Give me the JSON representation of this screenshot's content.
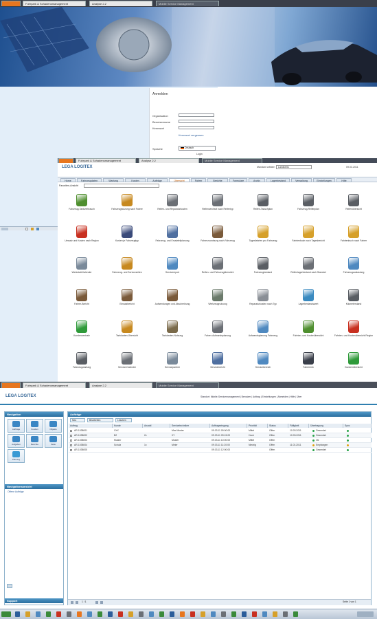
{
  "screen1": {
    "tabs": [
      "",
      "Fuhrpark & Schadensmanagement",
      "Analyse 2.2",
      "Mobile Service Management"
    ],
    "login": {
      "title": "Anmelden",
      "fields": [
        {
          "label": "Organisation",
          "value": ""
        },
        {
          "label": "Benutzername",
          "value": ""
        },
        {
          "label": "Kennwort",
          "value": ""
        }
      ],
      "forgot": "Kennwort vergessen",
      "language_label": "Sprache",
      "language_value": "Deutsch",
      "login_button": "Login"
    }
  },
  "screen2": {
    "tabs": [
      "",
      "Fuhrpark & Schadensmanagement",
      "Analyse 2.2",
      "Mobile Service Management"
    ],
    "logo": "LEGA LOGITEX",
    "mandant_label": "Mandant wählen",
    "mandant_value": "Landkreis",
    "date": "09.03.2011",
    "menu": [
      "Home",
      "Fahrzeugdaten",
      "Wartung",
      "Kosten",
      "Aufträge",
      "Übersicht",
      "Fahrer",
      "Berichte",
      "Formulare",
      "Archiv",
      "Lagerbestand",
      "Verwaltung",
      "Einstellungen",
      "Hilfe"
    ],
    "filter_label": "Favoriten-Ansicht",
    "icons": [
      {
        "label": "Fahrzeug-Tankverbrauch",
        "color": "#4f8f2f"
      },
      {
        "label": "Fahrzeugnutzung nach Fahrer",
        "color": "#c7891f"
      },
      {
        "label": "Reifen- und Reparaturkosten",
        "color": "#6b6f75"
      },
      {
        "label": "Reifenwechsel nach Reifentyp",
        "color": "#6b6f75"
      },
      {
        "label": "Reifen-Tauschplan",
        "color": "#5a5e64"
      },
      {
        "label": "Fahrzeug-Reifenplan",
        "color": "#5a5e64"
      },
      {
        "label": "Reifenübersicht",
        "color": "#5a5e64"
      },
      {
        "label": "Umsatz und Kosten nach Region",
        "color": "#c83020"
      },
      {
        "label": "Kosten je Fahrzeugtyp",
        "color": "#3a4a7a"
      },
      {
        "label": "Fahrzeug- und Ersatzteilplanung",
        "color": "#4f6fa0"
      },
      {
        "label": "Fahrerzuordnung nach Fahrzeug",
        "color": "#7a5a3a"
      },
      {
        "label": "Tagesfahrten pro Fahrzeug",
        "color": "#d6a02a"
      },
      {
        "label": "Fahrtenbuch nach Tagesbericht",
        "color": "#d6a02a"
      },
      {
        "label": "Fahrtenbuch nach Fahrer",
        "color": "#d6a02a"
      },
      {
        "label": "Werkstatt-Kalender",
        "color": "#7a8a9a"
      },
      {
        "label": "Fahrzeug- und Servicezeiten",
        "color": "#c7891f"
      },
      {
        "label": "Servicereport",
        "color": "#4f89c0"
      },
      {
        "label": "Reifen- und Fahrzeugübersicht",
        "color": "#6b6f75"
      },
      {
        "label": "Fahrzeugbestand",
        "color": "#5a5e64"
      },
      {
        "label": "Reifenlagerbestand nach Standort",
        "color": "#6b6f75"
      },
      {
        "label": "Fahrzeugauslastung",
        "color": "#4f89c0"
      },
      {
        "label": "Fahrer-Bericht",
        "color": "#7a5a3a"
      },
      {
        "label": "Einsatzbericht",
        "color": "#7a5a3a"
      },
      {
        "label": "Aufwendungen und Abschreibung",
        "color": "#7a5a3a"
      },
      {
        "label": "Werkzeugnutzung",
        "color": "#6b7a6b"
      },
      {
        "label": "Reparaturkosten nach Typ",
        "color": "#8a8f96"
      },
      {
        "label": "Lagerbestandswert",
        "color": "#3a8ac0"
      },
      {
        "label": "Kilometerstand",
        "color": "#5a5e64"
      },
      {
        "label": "Kundenzentrale",
        "color": "#2f9a3a"
      },
      {
        "label": "Tankkarten-Übersicht",
        "color": "#c7891f"
      },
      {
        "label": "Tankkarten-Nutzung",
        "color": "#7a6a4a"
      },
      {
        "label": "Fahrer-Aufwandsplanung",
        "color": "#6b6f75"
      },
      {
        "label": "Aufwandsplanung Fahrzeug",
        "color": "#4f89c0"
      },
      {
        "label": "Fahrten- und Kostenübersicht",
        "color": "#4f8f2f"
      },
      {
        "label": "Fahrten- und Kostenübersicht Region",
        "color": "#c83020"
      },
      {
        "label": "Fahrzeugwartung",
        "color": "#5a5e64"
      },
      {
        "label": "Service-Kalender",
        "color": "#6b6f75"
      },
      {
        "label": "Servicepartner",
        "color": "#7a8a9a"
      },
      {
        "label": "Servicebericht",
        "color": "#4f6fa0"
      },
      {
        "label": "Servicebereich",
        "color": "#4f89c0"
      },
      {
        "label": "Fahrerinfo",
        "color": "#3a3f4a"
      },
      {
        "label": "Kundenübersicht",
        "color": "#2f9a3a"
      }
    ]
  },
  "screen3": {
    "tabs": [
      "",
      "Fuhrpark & Schadensmanagement",
      "Analyse 2.2",
      "Mobile Service Management"
    ],
    "logo": "LEGA LOGITEX",
    "topline": "Standort: Mobile-Servicemanagement | Benutzer | Auftrag | Einstellungen | Abmelden | Hilfe | Über",
    "nav_title": "Navigation",
    "nav_tiles": [
      "Aufträge",
      "Kunden",
      "Objekte",
      "Aufgaben",
      "Berichte",
      "Karte",
      "Planung"
    ],
    "nav_section": "Navigationsansicht",
    "nav_entry": "Offene Aufträge",
    "support": "Support",
    "main_title": "Aufträge",
    "toolbar": [
      "Neu",
      "Bearbeiten",
      "Löschen"
    ],
    "columns": [
      "Auftrag",
      "Kunde",
      "Anzahl",
      "Servicetechniker",
      "Auftragseingang",
      "Priorität",
      "Status",
      "Fälligkeit",
      "Übertragung",
      "Sync"
    ],
    "rows": [
      {
        "id": "AR-1038001",
        "kunde": "XXX",
        "anz": "",
        "tech": "Max Muster",
        "date": "09.03.11 09:00:00",
        "prio": "Mittel",
        "status": "Offen",
        "faellig": "10.03.2011",
        "sync": "Gesendet",
        "dot": "#2aa34a"
      },
      {
        "id": "AR-1038002",
        "kunde": "B2",
        "anz": "2x",
        "tech": "XY",
        "date": "09.03.11 09:15:00",
        "prio": "Hoch",
        "status": "Offen",
        "faellig": "10.03.2011",
        "sync": "Gesendet",
        "dot": "#2aa34a"
      },
      {
        "id": "AR-1038003",
        "kunde": "Muster",
        "anz": "",
        "tech": "Muster",
        "date": "09.03.11 10:00:00",
        "prio": "Mittel",
        "status": "Offen",
        "faellig": "",
        "sync": "Ok",
        "dot": "#2aa34a"
      },
      {
        "id": "AR-1038004",
        "kunde": "Schulz",
        "anz": "1x",
        "tech": "Meier",
        "date": "09.03.11 11:20:00",
        "prio": "Niedrig",
        "status": "Offen",
        "faellig": "11.03.2011",
        "sync": "Empfangen",
        "dot": "#e0a010"
      },
      {
        "id": "AR-1038005",
        "kunde": "",
        "anz": "",
        "tech": "",
        "date": "09.03.11 12:00:00",
        "prio": "",
        "status": "Offen",
        "faellig": "",
        "sync": "Gesendet",
        "dot": "#2aa34a"
      }
    ],
    "pager": "1 / 1",
    "status_right": "Seite 1 von 1"
  }
}
